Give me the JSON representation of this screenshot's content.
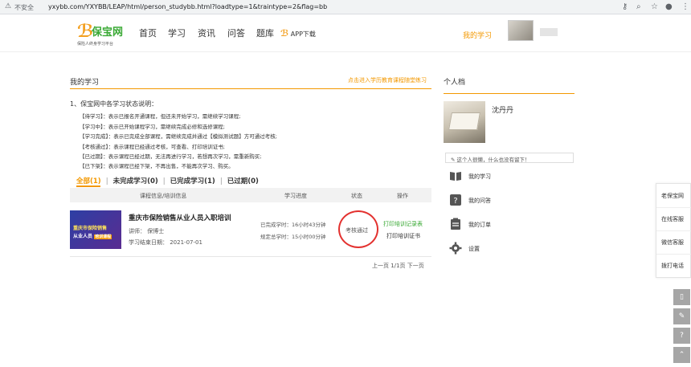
{
  "browser": {
    "security_label": "不安全",
    "url": "yxybb.com/YXYBB/LEAP/html/person_studybb.html?loadtype=1&traintype=2&flag=bb"
  },
  "header": {
    "logo_name": "保宝网",
    "logo_slogan": "保险人终身学习平台",
    "nav": [
      "首页",
      "学习",
      "资讯",
      "问答",
      "题库"
    ],
    "app_download": "APP下载",
    "my_learning_link": "我的学习"
  },
  "main": {
    "title": "我的学习",
    "promo_link": "点击进入学历教育课程随堂练习",
    "explain_title": "1、保宝网中各学习状态说明：",
    "explain_lines": [
      {
        "text": "【待学习】：表示已报名开通课程，但还未开始学习，需继续学习课程;",
        "highlight": false
      },
      {
        "text": "【学习中】：表示已开始课程学习，需继续完成必修和选修课程;",
        "highlight": false
      },
      {
        "text": "【学习完成】：表示已完成全部课程，需继续完成并通过【模拟测试题】方可通过考核;",
        "highlight": true
      },
      {
        "text": "【考核通过】：表示课程已经通过考核，可查看、打印培训证书;",
        "highlight": false
      },
      {
        "text": "【已过期】：表示课程已经过期，无法再进行学习，若想再次学习，需重新购买;",
        "highlight": false
      },
      {
        "text": "【已下架】：表示课程已经下架，不再出售，不能再次学习、购买。",
        "highlight": false
      }
    ],
    "tabs": [
      "全部(1)",
      "未完成学习(0)",
      "已完成学习(1)",
      "已过期(0)"
    ],
    "table_headers": [
      "课程信息/培训信息",
      "学习进度",
      "状态",
      "操作"
    ],
    "course": {
      "image_line1": "重庆市保险销售",
      "image_line2": "从业人员",
      "image_badge": "培训课程",
      "title": "重庆市保险销售从业人员入职培训",
      "lecturer": "讲师：  保博士",
      "end_date": "学习结束日期：  2021-07-01",
      "completed_hours": "已完成学时：16小时43分钟",
      "required_hours": "规定总学时：15小时00分钟",
      "status": "考核通过",
      "op_print_record": "打印培训记录表",
      "op_print_cert": "打印培训证书"
    },
    "pagination": "上一页  1/1页  下一页"
  },
  "profile": {
    "title": "个人档",
    "name": "沈丹丹",
    "signature": "这个人很懒，什么也没有留下！",
    "menu": [
      {
        "label": "我的学习",
        "icon": "book-icon"
      },
      {
        "label": "我的问答",
        "icon": "question-icon"
      },
      {
        "label": "我的订单",
        "icon": "order-icon"
      },
      {
        "label": "设置",
        "icon": "gear-icon"
      }
    ]
  },
  "float_panel": {
    "items": [
      "老保宝网",
      "在线客服",
      "微信客服",
      "拨打电话"
    ]
  },
  "colors": {
    "accent": "#f39800",
    "brand_green": "#3aa935",
    "status_circle": "#e3312f"
  }
}
